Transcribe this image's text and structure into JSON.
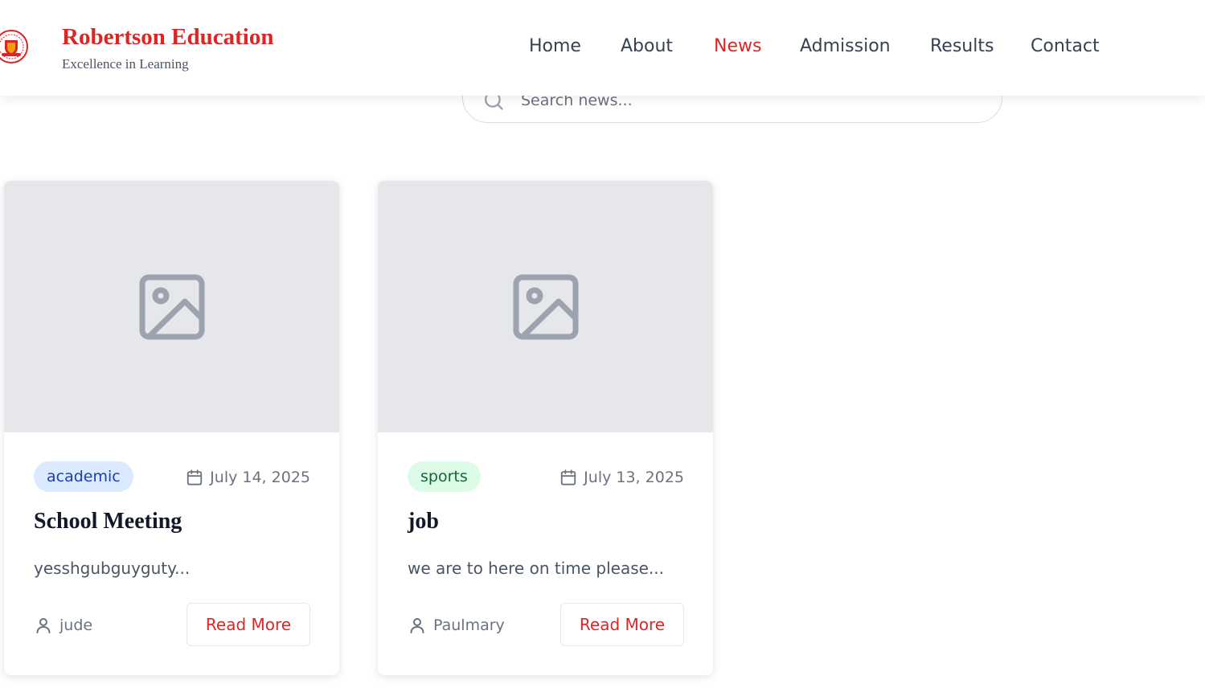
{
  "header": {
    "brand_title": "Robertson Education",
    "brand_subtitle": "Excellence in Learning",
    "logo_icon": "school-crest-icon",
    "nav": [
      {
        "label": "Home",
        "active": false
      },
      {
        "label": "About",
        "active": false
      },
      {
        "label": "News",
        "active": true
      },
      {
        "label": "Admission",
        "active": false
      },
      {
        "label": "Results",
        "active": false
      },
      {
        "label": "Contact",
        "active": false
      }
    ]
  },
  "search": {
    "placeholder": "Search news...",
    "value": "",
    "icon": "search-icon"
  },
  "news": [
    {
      "category": "academic",
      "category_color": "#1e40af",
      "date": "July 14, 2025",
      "title": "School Meeting",
      "excerpt": "yesshgubguyguty...",
      "author": "jude",
      "read_more_label": "Read More"
    },
    {
      "category": "sports",
      "category_color": "#166534",
      "date": "July 13, 2025",
      "title": "job",
      "excerpt": "we are to here on time please...",
      "author": "Paulmary",
      "read_more_label": "Read More"
    }
  ],
  "colors": {
    "accent": "#dc2626",
    "text_dark": "#374151",
    "image_placeholder_bg": "#e5e7eb"
  }
}
